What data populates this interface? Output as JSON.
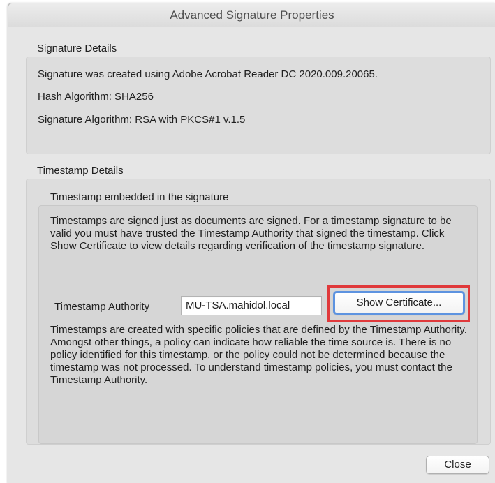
{
  "dialog": {
    "title": "Advanced Signature Properties"
  },
  "signature_details": {
    "heading": "Signature Details",
    "created_with": "Signature was created using Adobe Acrobat Reader DC 2020.009.20065.",
    "hash_algorithm": "Hash Algorithm: SHA256",
    "signature_algorithm": "Signature Algorithm: RSA with PKCS#1 v.1.5"
  },
  "timestamp_details": {
    "heading": "Timestamp Details",
    "embedded_label": "Timestamp embedded in the signature",
    "description": "Timestamps are signed just as documents are signed. For a timestamp signature to be valid you must have trusted the Timestamp Authority that signed the timestamp. Click Show Certificate to view details regarding verification of the timestamp signature.",
    "authority_label": "Timestamp Authority",
    "authority_value": "MU-TSA.mahidol.local",
    "show_certificate_label": "Show Certificate...",
    "policy_text": "Timestamps are created with specific policies that are defined by the Timestamp Authority. Amongst other things, a policy can indicate how reliable the time source is. There is no policy identified for this timestamp, or the policy could not be determined because the timestamp was not processed. To understand timestamp policies, you must contact the Timestamp Authority."
  },
  "footer": {
    "close_label": "Close"
  },
  "colors": {
    "highlight": "#e0393b",
    "focus_ring": "#5d93e0",
    "dialog_bg": "#e6e6e6"
  },
  "icons": {
    "cursor": "mouse-pointer-icon"
  }
}
